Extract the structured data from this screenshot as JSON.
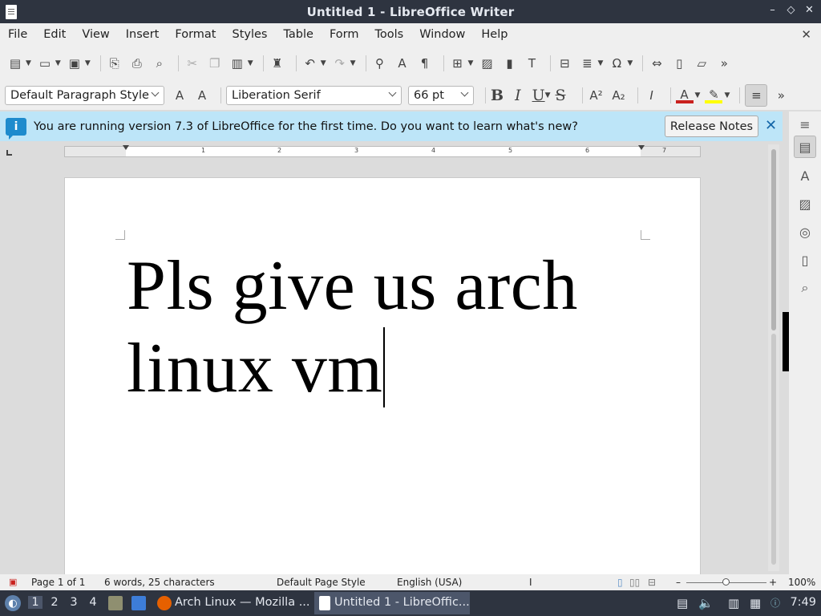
{
  "window": {
    "title": "Untitled 1 - LibreOffice Writer",
    "controls": {
      "minimize": "–",
      "maximize": "◇",
      "close": "✕"
    }
  },
  "menubar": {
    "items": [
      "File",
      "Edit",
      "View",
      "Insert",
      "Format",
      "Styles",
      "Table",
      "Form",
      "Tools",
      "Window",
      "Help"
    ],
    "close_document": "✕"
  },
  "formatting": {
    "paragraph_style": "Default Paragraph Style",
    "font_name": "Liberation Serif",
    "font_size": "66 pt",
    "bold": "B",
    "italic": "I",
    "underline": "U",
    "strikethrough": "S",
    "font_color": "#c9211e",
    "highlight_color": "#ffff00"
  },
  "infobar": {
    "message": "You are running version 7.3 of LibreOffice for the first time. Do you want to learn what's new?",
    "button": "Release Notes",
    "close": "✕"
  },
  "ruler": {
    "numbers": [
      "1",
      "2",
      "3",
      "4",
      "5",
      "6",
      "7"
    ]
  },
  "document": {
    "text": "Pls give us arch linux vm"
  },
  "statusbar": {
    "page": "Page 1 of 1",
    "words": "6 words, 25 characters",
    "page_style": "Default Page Style",
    "language": "English (USA)",
    "zoom": "100%"
  },
  "taskbar": {
    "workspaces": [
      "1",
      "2",
      "3",
      "4"
    ],
    "tasks": [
      "Arch Linux — Mozilla ...",
      "Untitled 1 - LibreOffic..."
    ],
    "clock": "7:49"
  },
  "icons": {
    "sidebar": [
      "properties-icon",
      "styles-icon",
      "gallery-icon",
      "navigator-icon",
      "page-icon",
      "style-inspector-icon"
    ]
  }
}
